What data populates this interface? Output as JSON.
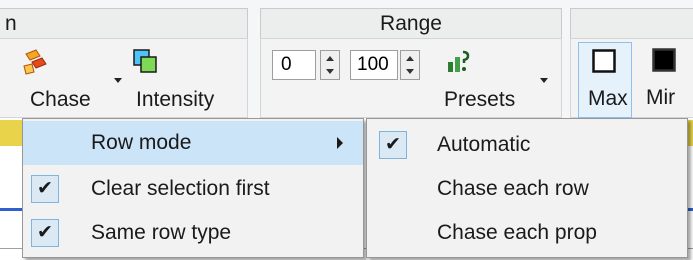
{
  "ribbon": {
    "groups": [
      {
        "header": "n"
      },
      {
        "header": "Range"
      },
      {
        "header": ""
      }
    ],
    "chase_label": "Chase",
    "intensity_label": "Intensity",
    "range_from": "0",
    "range_to": "100",
    "presets_label": "Presets",
    "max_label": "Max",
    "min_label": "Mir"
  },
  "menu": {
    "items": [
      {
        "label": "Row mode",
        "checked": false
      },
      {
        "label": "Clear selection first",
        "checked": true
      },
      {
        "label": "Same row type",
        "checked": true
      }
    ]
  },
  "submenu": {
    "items": [
      {
        "label": "Automatic",
        "checked": true
      },
      {
        "label": "Chase each row",
        "checked": false
      },
      {
        "label": "Chase each prop",
        "checked": false
      }
    ]
  },
  "check_mark": "✔",
  "colors": {
    "highlight": "#cce4f7",
    "check_box": "#dbe9f5",
    "check_border": "#7fb5dd",
    "menu_bg": "#f2f2f2"
  }
}
